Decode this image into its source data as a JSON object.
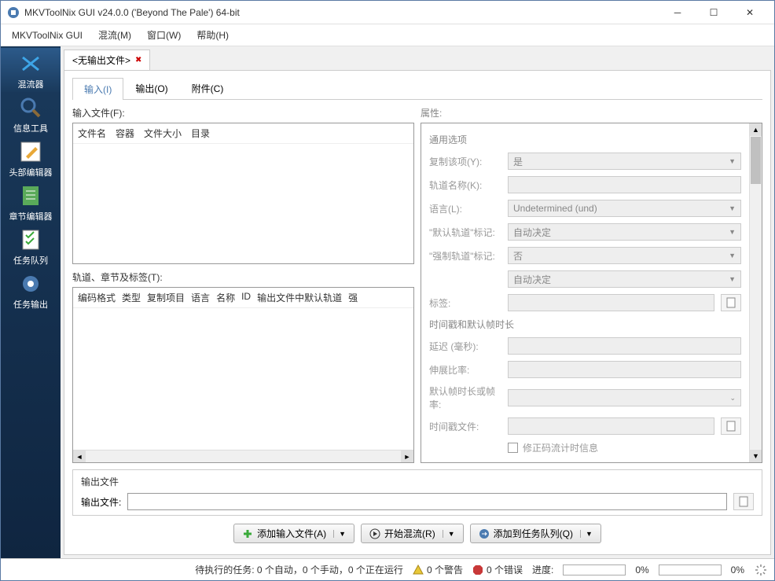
{
  "titlebar": {
    "text": "MKVToolNix GUI v24.0.0 ('Beyond The Pale') 64-bit"
  },
  "menubar": {
    "items": [
      "MKVToolNix GUI",
      "混流(M)",
      "窗口(W)",
      "帮助(H)"
    ]
  },
  "sidebar": {
    "items": [
      {
        "label": "混流器"
      },
      {
        "label": "信息工具"
      },
      {
        "label": "头部编辑器"
      },
      {
        "label": "章节编辑器"
      },
      {
        "label": "任务队列"
      },
      {
        "label": "任务输出"
      }
    ]
  },
  "file_tab": {
    "label": "<无输出文件>"
  },
  "io_tabs": {
    "items": [
      "输入(I)",
      "输出(O)",
      "附件(C)"
    ]
  },
  "input_files": {
    "label": "输入文件(F):",
    "columns": [
      "文件名",
      "容器",
      "文件大小",
      "目录"
    ]
  },
  "tracks": {
    "label": "轨道、章节及标签(T):",
    "columns": [
      "编码格式",
      "类型",
      "复制项目",
      "语言",
      "名称",
      "ID",
      "输出文件中默认轨道",
      "强"
    ]
  },
  "properties": {
    "label": "属性:",
    "group1_title": "通用选项",
    "copy": {
      "label": "复制该项(Y):",
      "value": "是"
    },
    "track_name": {
      "label": "轨道名称(K):",
      "value": ""
    },
    "language": {
      "label": "语言(L):",
      "value": "Undetermined (und)"
    },
    "default_flag": {
      "label": "\"默认轨道\"标记:",
      "value": "自动决定"
    },
    "forced_flag": {
      "label": "\"强制轨道\"标记:",
      "value": "否"
    },
    "unnamed": {
      "label": "",
      "value": "自动决定"
    },
    "tags": {
      "label": "标签:",
      "value": ""
    },
    "group2_title": "时间戳和默认帧时长",
    "delay": {
      "label": "延迟 (毫秒):",
      "value": ""
    },
    "stretch": {
      "label": "伸展比率:",
      "value": ""
    },
    "default_duration": {
      "label": "默认帧时长或帧率:",
      "value": ""
    },
    "timestamp_file": {
      "label": "时间戳文件:",
      "value": ""
    },
    "fix_bitstream": {
      "label": "修正码流计时信息"
    }
  },
  "output": {
    "title": "输出文件",
    "label": "输出文件:",
    "value": ""
  },
  "actions": {
    "add_files": "添加输入文件(A)",
    "start_mux": "开始混流(R)",
    "add_to_queue": "添加到任务队列(Q)"
  },
  "statusbar": {
    "pending": "待执行的任务: 0 个自动，0 个手动，0 个正在运行",
    "warnings": "0 个警告",
    "errors": "0 个错误",
    "progress_label": "进度:",
    "progress1": "0%",
    "progress2": "0%"
  }
}
